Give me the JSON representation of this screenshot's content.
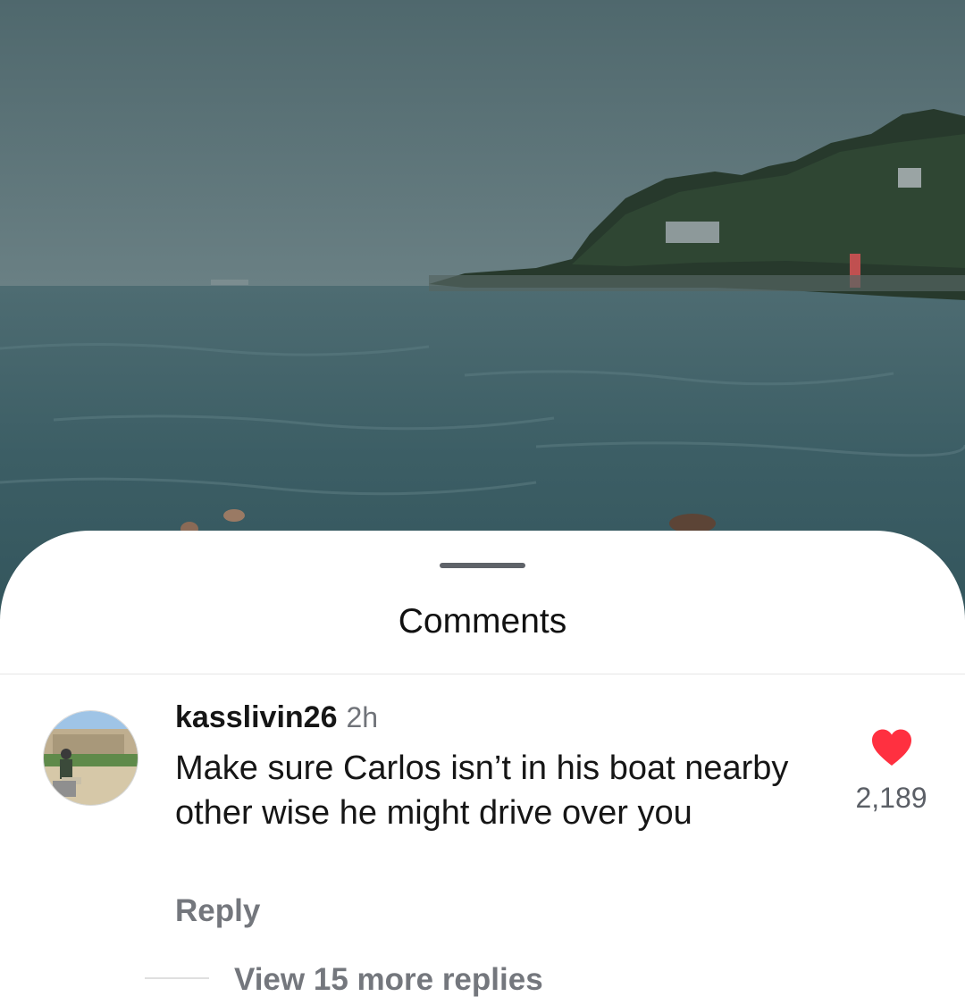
{
  "sheet": {
    "title": "Comments"
  },
  "comment": {
    "username": "kasslivin26",
    "time": "2h",
    "text": "Make sure Carlos isn’t in his boat nearby other wise he might drive over you",
    "reply_label": "Reply",
    "like_count": "2,189",
    "liked": true,
    "view_replies_label": "View 15 more replies"
  },
  "colors": {
    "heart": "#ff3040",
    "sky": "#5c7478",
    "sea": "#3f6168"
  }
}
